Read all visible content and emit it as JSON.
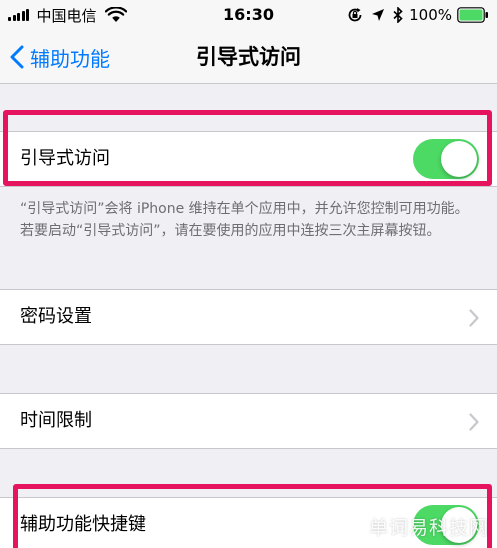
{
  "status_bar": {
    "carrier": "中国电信",
    "time": "16:30",
    "battery_percent": "100%",
    "icons": [
      "signal-icon",
      "wifi-icon",
      "orientation-lock-icon",
      "location-icon",
      "bluetooth-icon",
      "battery-icon"
    ]
  },
  "nav": {
    "back_label": "辅助功能",
    "title": "引导式访问"
  },
  "sections": {
    "guided_access": {
      "label": "引导式访问",
      "toggle_on": true
    },
    "footnote": "“引导式访问”会将 iPhone 维持在单个应用中，并允许您控制可用功能。若要启动“引导式访问”，请在要使用的应用中连按三次主屏幕按钮。",
    "passcode": {
      "label": "密码设置"
    },
    "time_limits": {
      "label": "时间限制"
    },
    "shortcut": {
      "label": "辅助功能快捷键",
      "toggle_on": true
    }
  },
  "colors": {
    "accent": "#007aff",
    "toggle_on": "#4cd964",
    "highlight": "#e6135e",
    "background": "#efeff4"
  },
  "watermark": "单词易科技网"
}
